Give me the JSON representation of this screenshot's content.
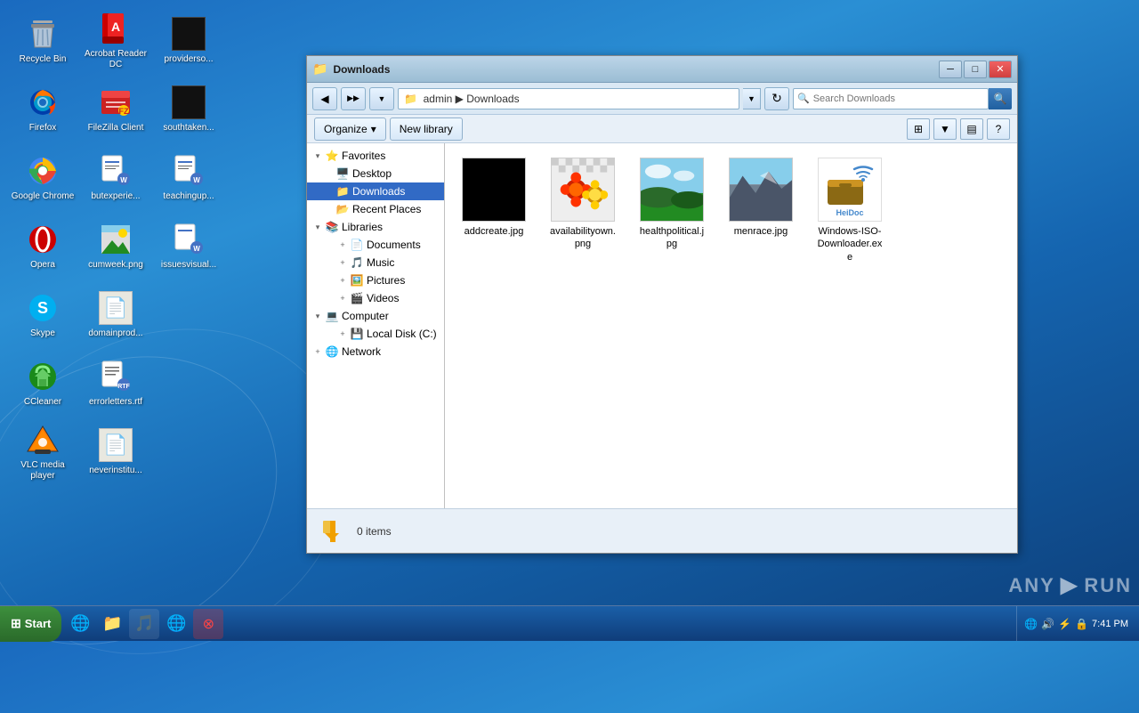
{
  "desktop": {
    "icons": [
      {
        "id": "recycle-bin",
        "label": "Recycle Bin",
        "emoji": "🗑️",
        "row": 1,
        "col": 1
      },
      {
        "id": "acrobat",
        "label": "Acrobat Reader DC",
        "emoji": "📄",
        "row": 1,
        "col": 2
      },
      {
        "id": "providers",
        "label": "providerso...",
        "emoji": "🖥️",
        "row": 1,
        "col": 3
      },
      {
        "id": "firefox",
        "label": "Firefox",
        "emoji": "🦊",
        "row": 2,
        "col": 1
      },
      {
        "id": "filezilla",
        "label": "FileZilla Client",
        "emoji": "📁",
        "row": 2,
        "col": 2
      },
      {
        "id": "southtaken",
        "label": "southtaken...",
        "emoji": "🖥️",
        "row": 2,
        "col": 3
      },
      {
        "id": "chrome",
        "label": "Google Chrome",
        "emoji": "🌐",
        "row": 3,
        "col": 1
      },
      {
        "id": "butexperie",
        "label": "butexperie...",
        "emoji": "📄",
        "row": 3,
        "col": 2
      },
      {
        "id": "teachingup",
        "label": "teachingup...",
        "emoji": "📝",
        "row": 3,
        "col": 3
      },
      {
        "id": "opera",
        "label": "Opera",
        "emoji": "🅾️",
        "row": 4,
        "col": 1
      },
      {
        "id": "cumweek",
        "label": "cumweek.png",
        "emoji": "🖼️",
        "row": 4,
        "col": 2
      },
      {
        "id": "issuesvisual",
        "label": "issuesvisual...",
        "emoji": "📝",
        "row": 4,
        "col": 3
      },
      {
        "id": "skype",
        "label": "Skype",
        "emoji": "💬",
        "row": 5,
        "col": 1
      },
      {
        "id": "domainprod",
        "label": "domainprod...",
        "emoji": "📄",
        "row": 5,
        "col": 2
      },
      {
        "id": "ccleaner",
        "label": "CCleaner",
        "emoji": "🧹",
        "row": 6,
        "col": 1
      },
      {
        "id": "errorletters",
        "label": "errorletters.rtf",
        "emoji": "📝",
        "row": 6,
        "col": 2
      },
      {
        "id": "vlc",
        "label": "VLC media player",
        "emoji": "🎬",
        "row": 7,
        "col": 1
      },
      {
        "id": "neverinstitu",
        "label": "neverinstitu...",
        "emoji": "📄",
        "row": 7,
        "col": 2
      }
    ]
  },
  "explorer": {
    "title": "Downloads",
    "title_icon": "📁",
    "nav": {
      "back_label": "◀",
      "forward_label": "▶",
      "up_label": "↑",
      "address": "admin ▶ Downloads",
      "search_placeholder": "Search Downloads",
      "refresh_label": "↻"
    },
    "toolbar": {
      "organize_label": "Organize",
      "organize_arrow": "▾",
      "new_library_label": "New library",
      "help_label": "?"
    },
    "tree": {
      "items": [
        {
          "id": "favorites",
          "label": "Favorites",
          "indent": 0,
          "expanded": true,
          "icon": "⭐",
          "type": "group"
        },
        {
          "id": "desktop",
          "label": "Desktop",
          "indent": 1,
          "expanded": false,
          "icon": "🖥️",
          "type": "leaf"
        },
        {
          "id": "downloads",
          "label": "Downloads",
          "indent": 1,
          "expanded": false,
          "icon": "📁",
          "type": "leaf",
          "selected": true
        },
        {
          "id": "recent-places",
          "label": "Recent Places",
          "indent": 1,
          "expanded": false,
          "icon": "📂",
          "type": "leaf"
        },
        {
          "id": "libraries",
          "label": "Libraries",
          "indent": 0,
          "expanded": true,
          "icon": "📚",
          "type": "group"
        },
        {
          "id": "documents",
          "label": "Documents",
          "indent": 1,
          "expanded": false,
          "icon": "📄",
          "type": "leaf"
        },
        {
          "id": "music",
          "label": "Music",
          "indent": 1,
          "expanded": false,
          "icon": "🎵",
          "type": "leaf"
        },
        {
          "id": "pictures",
          "label": "Pictures",
          "indent": 1,
          "expanded": false,
          "icon": "🖼️",
          "type": "leaf"
        },
        {
          "id": "videos",
          "label": "Videos",
          "indent": 1,
          "expanded": false,
          "icon": "🎬",
          "type": "leaf"
        },
        {
          "id": "computer",
          "label": "Computer",
          "indent": 0,
          "expanded": true,
          "icon": "💻",
          "type": "group"
        },
        {
          "id": "local-disk",
          "label": "Local Disk (C:)",
          "indent": 1,
          "expanded": false,
          "icon": "💾",
          "type": "leaf"
        },
        {
          "id": "network",
          "label": "Network",
          "indent": 0,
          "expanded": false,
          "icon": "🌐",
          "type": "group"
        }
      ]
    },
    "files": [
      {
        "id": "addcreate",
        "name": "addcreate.jpg",
        "type": "jpg",
        "thumb": "black"
      },
      {
        "id": "availabilityown",
        "name": "availabilityown.png",
        "type": "png",
        "thumb": "flower"
      },
      {
        "id": "healthpolitical",
        "name": "healthpolitical.jpg",
        "type": "jpg",
        "thumb": "landscape"
      },
      {
        "id": "menrace",
        "name": "menrace.jpg",
        "type": "jpg",
        "thumb": "mountain"
      },
      {
        "id": "windows-iso",
        "name": "Windows-ISO-Downloader.exe",
        "type": "exe",
        "thumb": "heidoc"
      }
    ],
    "status": {
      "text": "0 items",
      "icon": "📥"
    }
  },
  "taskbar": {
    "start_label": "Start",
    "pinned": [
      {
        "id": "ie",
        "icon": "🌐",
        "label": "Internet Explorer"
      },
      {
        "id": "explorer",
        "icon": "📁",
        "label": "Windows Explorer"
      },
      {
        "id": "media",
        "icon": "🎵",
        "label": "Media Player"
      },
      {
        "id": "chrome-task",
        "icon": "🌐",
        "label": "Chrome"
      },
      {
        "id": "stop",
        "icon": "🛑",
        "label": "Stop"
      }
    ],
    "clock": "7:41 PM",
    "tray_icons": [
      "🔊",
      "🔒",
      "📶",
      "⚡"
    ]
  },
  "anyrun": {
    "label": "ANY RUN"
  }
}
